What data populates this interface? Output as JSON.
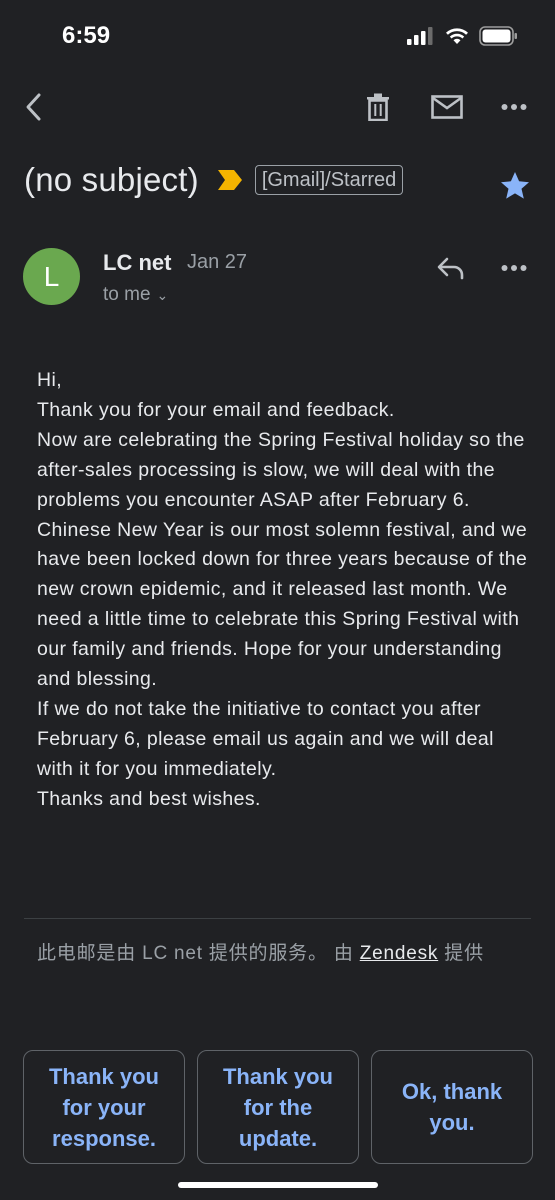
{
  "status": {
    "time": "6:59"
  },
  "email": {
    "subject": "(no subject)",
    "label": "[Gmail]/Starred",
    "sender": {
      "initial": "L",
      "name": "LC net",
      "date": "Jan 27",
      "recipient": "to me"
    },
    "body": [
      "Hi,",
      "Thank you for your email and feedback.",
      "Now are celebrating the Spring Festival holiday so the after-sales processing is slow, we will deal with the problems you encounter ASAP after February 6.",
      "Chinese New Year is our most solemn festival, and we have been locked down for three years because of the new crown epidemic, and it released last month. We need a little time to celebrate this Spring Festival with our family and friends. Hope for your understanding and blessing.",
      "If we do not take the initiative to contact you after February 6, please email us again and we will deal with it for you immediately.",
      "Thanks and best wishes."
    ],
    "footer": {
      "prefix": "此电邮是由 LC net 提供的服务。 由 ",
      "link": "Zendesk",
      "suffix": " 提供"
    }
  },
  "smart_replies": [
    "Thank you for your response.",
    "Thank you for the update.",
    "Ok, thank you."
  ],
  "colors": {
    "background": "#202124",
    "accent": "#8ab4f8",
    "star": "#8ab4f8",
    "important": "#f4b400",
    "avatar": "#6aa84f"
  }
}
